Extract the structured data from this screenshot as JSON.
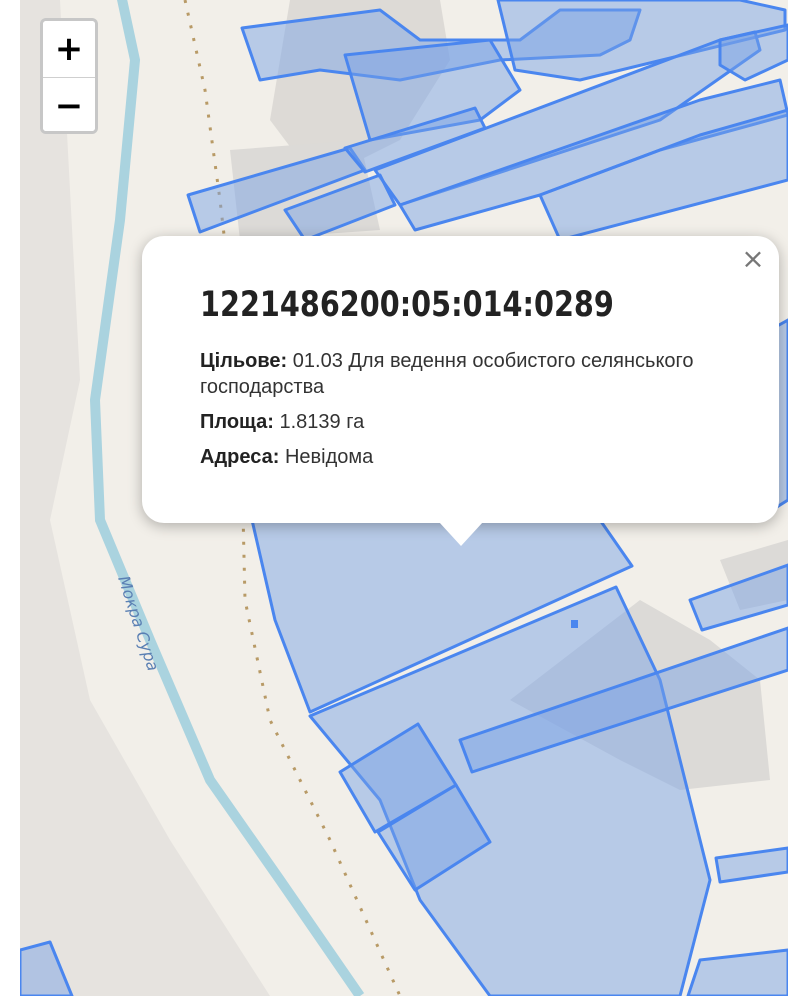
{
  "map": {
    "river_label": "Мокра Сура",
    "colors": {
      "background": "#f2efe9",
      "river": "#aad3df",
      "parcel_stroke": "#4a86ef",
      "parcel_fill": "#78a0e6",
      "track": "#b89a66",
      "building": "#d9d0c9"
    }
  },
  "zoom": {
    "in_label": "+",
    "out_label": "−"
  },
  "popup": {
    "close_label": "×",
    "cadastral_number": "1221486200:05:014:0289",
    "purpose_label": "Цільове:",
    "purpose_value": "01.03 Для ведення особистого селянського господарства",
    "area_label": "Площа:",
    "area_value": "1.8139 га",
    "address_label": "Адреса:",
    "address_value": "Невідома"
  }
}
